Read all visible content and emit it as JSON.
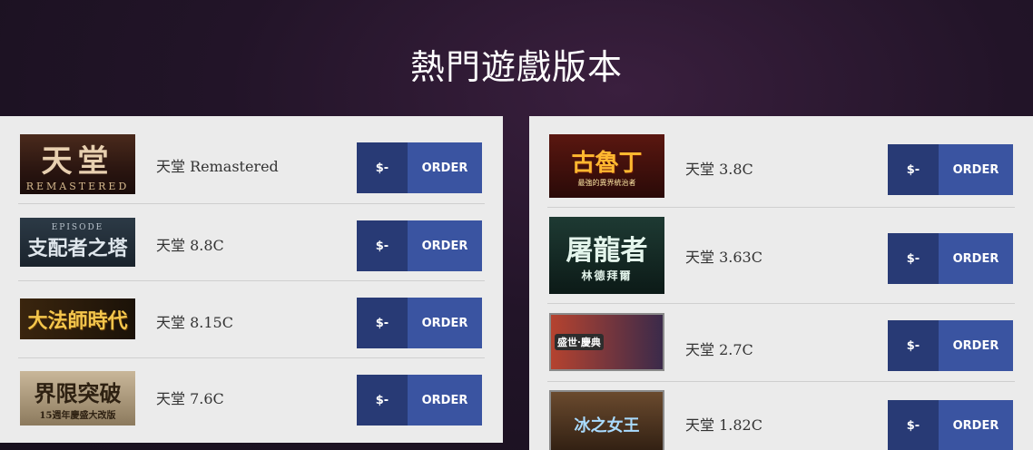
{
  "page": {
    "title": "熱門遊戲版本"
  },
  "left_column": [
    {
      "name": "天堂 Remastered",
      "price": "$-",
      "order": "ORDER",
      "thumb": {
        "big": "天堂",
        "small": "REMASTERED",
        "style": "t-rem"
      }
    },
    {
      "name": "天堂 8.8C",
      "price": "$-",
      "order": "ORDER",
      "thumb": {
        "small": "EPISODE",
        "big": "支配者之塔",
        "style": "t-ep"
      }
    },
    {
      "name": "天堂 8.15C",
      "price": "$-",
      "order": "ORDER",
      "thumb": {
        "big": "大法師時代",
        "style": "t-mage"
      }
    },
    {
      "name": "天堂 7.6C",
      "price": "$-",
      "order": "ORDER",
      "thumb": {
        "big": "界限突破",
        "small": "15週年慶盛大改版",
        "style": "t-brk"
      }
    }
  ],
  "right_column": [
    {
      "name": "天堂 3.8C",
      "price": "$-",
      "order": "ORDER",
      "thumb": {
        "big": "古魯丁",
        "small": "最強的異界統治者",
        "style": "t-tower"
      }
    },
    {
      "name": "天堂 3.63C",
      "price": "$-",
      "order": "ORDER",
      "thumb": {
        "big": "屠龍者",
        "small": "林德拜爾",
        "style": "t-dragon"
      }
    },
    {
      "name": "天堂 2.7C",
      "price": "$-",
      "order": "ORDER",
      "thumb": {
        "small": "盛世·慶典",
        "style": "t-fest"
      }
    },
    {
      "name": "天堂 1.82C",
      "price": "$-",
      "order": "ORDER",
      "thumb": {
        "big": "冰之女王",
        "style": "t-ice"
      }
    }
  ]
}
